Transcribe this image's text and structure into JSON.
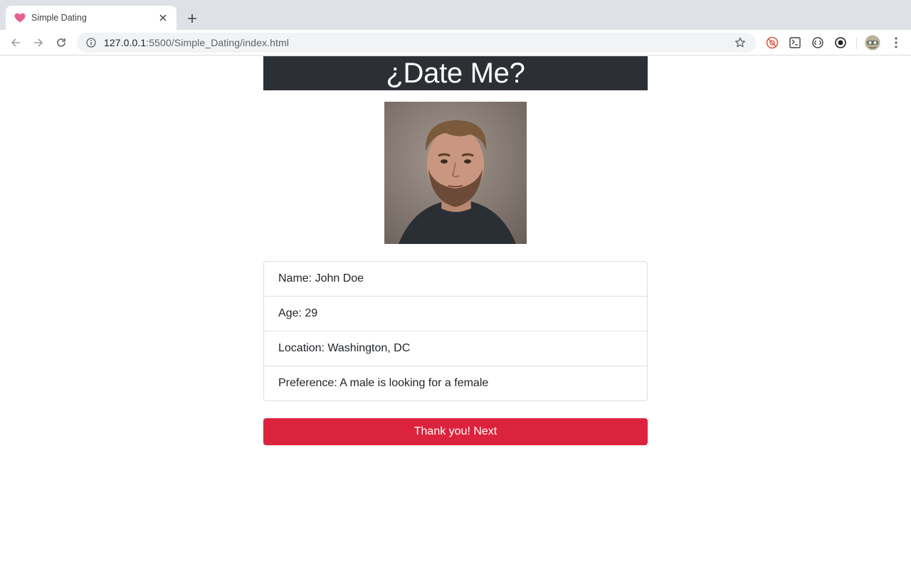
{
  "browser": {
    "tab": {
      "title": "Simple Dating",
      "favicon": "heart-icon"
    },
    "address": {
      "host": "127.0.0.1",
      "path": ":5500/Simple_Dating/index.html"
    },
    "icons": [
      "back-arrow-icon",
      "forward-arrow-icon",
      "reload-icon",
      "site-info-icon",
      "bookmark-star-icon",
      "extension-icon",
      "menu-dots-icon",
      "profile-avatar-icon"
    ]
  },
  "page": {
    "title": "¿Date Me?",
    "profile": {
      "name": "Name: John Doe",
      "age": "Age: 29",
      "location": "Location: Washington, DC",
      "preference": "Preference: A male is looking for a female"
    },
    "next_button": "Thank you! Next"
  },
  "colors": {
    "header_bg": "#2c3035",
    "button_bg": "#dc233d",
    "favicon": "#e8618c"
  }
}
